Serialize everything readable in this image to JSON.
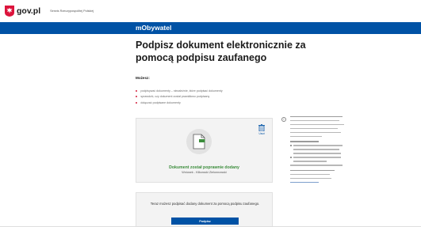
{
  "header": {
    "site_name": "gov.pl",
    "site_subtitle": "Serwis Rzeczypospolitej Polskiej"
  },
  "app_bar": {
    "title": "mObywatel",
    "color": "#0052a5"
  },
  "page": {
    "title": "Podpisz dokument elektronicznie za pomocą podpisu zaufanego"
  },
  "features": {
    "label": "Możesz:",
    "items": [
      "podpisywać dokumenty – niezależnie, które podpisać dokumenty",
      "sprawdzić, czy dokument został prawidłowo podpisany",
      "dołączać podpisane dokumenty"
    ],
    "bullet_color": "#d4213d"
  },
  "document_card": {
    "remove_label": "Usuń",
    "status": "Dokument został poprawnie dodany",
    "filename": "Wniosek - Kilkowski Zielonnowski",
    "status_color": "#3c8d3c"
  },
  "sign_card": {
    "text": "Teraz możesz podpisać dodany dokument za pomocą podpisu zaufanego.",
    "button_label": "Podpisz"
  },
  "icons": {
    "emblem": "polish-eagle-emblem-icon",
    "document": "document-file-icon",
    "trash": "trash-icon",
    "info": "info-icon"
  }
}
